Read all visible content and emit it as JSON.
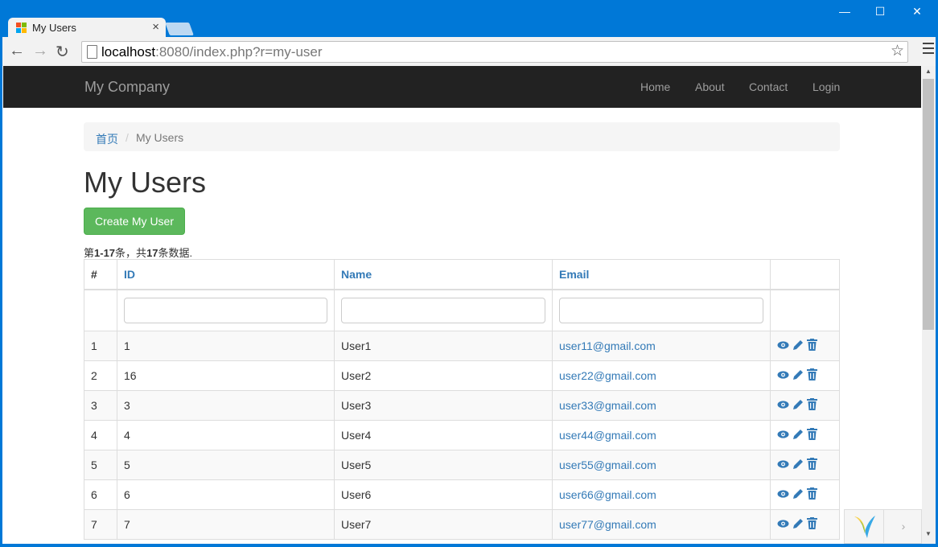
{
  "browser": {
    "tab_title": "My Users",
    "tab_close": "×",
    "url_host": "localhost",
    "url_rest": ":8080/index.php?r=my-user",
    "window_controls": {
      "minimize": "—",
      "maximize": "☐",
      "close": "✕"
    },
    "nav": {
      "back": "←",
      "forward": "→",
      "reload": "↻"
    },
    "bookmark_icon": "☆"
  },
  "navbar": {
    "brand": "My Company",
    "links": [
      "Home",
      "About",
      "Contact",
      "Login"
    ]
  },
  "breadcrumb": {
    "home": "首页",
    "separator": "/",
    "current": "My Users"
  },
  "page": {
    "title": "My Users",
    "create_button": "Create My User",
    "summary_prefix": "第",
    "summary_range": "1-17",
    "summary_mid": "条，共",
    "summary_total": "17",
    "summary_suffix": "条数据."
  },
  "grid": {
    "columns": [
      "#",
      "ID",
      "Name",
      "Email",
      ""
    ],
    "rows": [
      {
        "num": "1",
        "id": "1",
        "name": "User1",
        "email": "user11@gmail.com"
      },
      {
        "num": "2",
        "id": "16",
        "name": "User2",
        "email": "user22@gmail.com"
      },
      {
        "num": "3",
        "id": "3",
        "name": "User3",
        "email": "user33@gmail.com"
      },
      {
        "num": "4",
        "id": "4",
        "name": "User4",
        "email": "user44@gmail.com"
      },
      {
        "num": "5",
        "id": "5",
        "name": "User5",
        "email": "user55@gmail.com"
      },
      {
        "num": "6",
        "id": "6",
        "name": "User6",
        "email": "user66@gmail.com"
      },
      {
        "num": "7",
        "id": "7",
        "name": "User7",
        "email": "user77@gmail.com"
      }
    ],
    "action_icons": [
      "eye-icon",
      "pencil-icon",
      "trash-icon"
    ]
  },
  "debug_toolbar": {
    "toggle": "›"
  },
  "colors": {
    "primary": "#337ab7",
    "success": "#5cb85c",
    "navbar": "#222222",
    "chrome": "#0078d7"
  }
}
